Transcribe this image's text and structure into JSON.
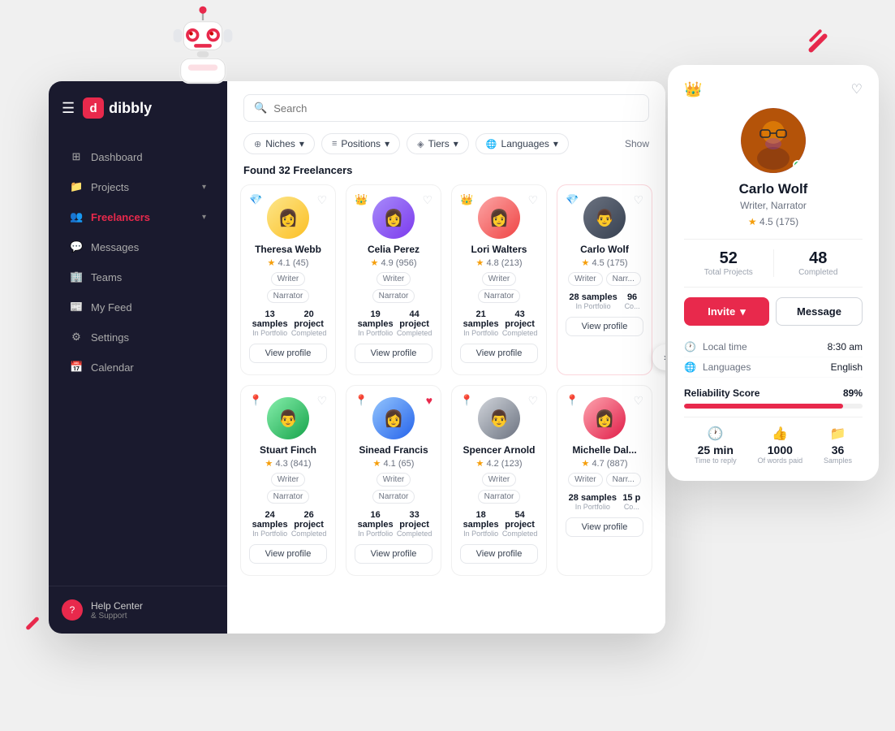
{
  "app": {
    "name": "dibbly",
    "logo_letter": "d"
  },
  "sidebar": {
    "items": [
      {
        "label": "Dashboard",
        "icon": "⊞",
        "active": false
      },
      {
        "label": "Projects",
        "icon": "📁",
        "active": false,
        "hasArrow": true
      },
      {
        "label": "Freelancers",
        "icon": "👥",
        "active": true,
        "hasArrow": true
      },
      {
        "label": "Messages",
        "icon": "💬",
        "active": false
      },
      {
        "label": "Teams",
        "icon": "🏢",
        "active": false
      },
      {
        "label": "My Feed",
        "icon": "📰",
        "active": false
      },
      {
        "label": "Settings",
        "icon": "⚙",
        "active": false
      },
      {
        "label": "Calendar",
        "icon": "📅",
        "active": false
      }
    ],
    "help": {
      "title": "Help Center",
      "subtitle": "& Support"
    }
  },
  "search": {
    "placeholder": "Search"
  },
  "filters": [
    {
      "label": "Niches",
      "icon": "⊕"
    },
    {
      "label": "Positions",
      "icon": "≡"
    },
    {
      "label": "Tiers",
      "icon": "◈"
    },
    {
      "label": "Languages",
      "icon": "🌐"
    }
  ],
  "results": {
    "count": "Found 32 Freelancers",
    "show_label": "Show"
  },
  "freelancers": [
    {
      "name": "Theresa Webb",
      "rating": "4.1",
      "reviews": "45",
      "tags": [
        "Writer",
        "Narrator"
      ],
      "badge": "💎",
      "heart": false,
      "samples": "13 samples",
      "samples_label": "In Portfolio",
      "projects": "20 project",
      "projects_label": "Completed",
      "btn": "View profile"
    },
    {
      "name": "Celia Perez",
      "rating": "4.9",
      "reviews": "956",
      "tags": [
        "Writer",
        "Narrator"
      ],
      "badge": "👑",
      "heart": false,
      "samples": "19 samples",
      "samples_label": "In Portfolio",
      "projects": "44 project",
      "projects_label": "Completed",
      "btn": "View profile"
    },
    {
      "name": "Lori Walters",
      "rating": "4.8",
      "reviews": "213",
      "tags": [
        "Writer",
        "Narrator"
      ],
      "badge": "👑",
      "heart": false,
      "samples": "21 samples",
      "samples_label": "In Portfolio",
      "projects": "43 project",
      "projects_label": "Completed",
      "btn": "View profile"
    },
    {
      "name": "Carlo Wolf",
      "rating": "4.5",
      "reviews": "175",
      "tags": [
        "Writer",
        "Narr..."
      ],
      "badge": "💎",
      "heart": false,
      "samples": "28 samples",
      "samples_label": "In Portfolio",
      "projects": "96",
      "projects_label": "Co...",
      "btn": "View profile"
    },
    {
      "name": "Stuart Finch",
      "rating": "4.3",
      "reviews": "841",
      "tags": [
        "Writer",
        "Narrator"
      ],
      "badge": "📍",
      "heart": false,
      "samples": "24 samples",
      "samples_label": "In Portfolio",
      "projects": "26 project",
      "projects_label": "Completed",
      "btn": "View profile"
    },
    {
      "name": "Sinead Francis",
      "rating": "4.1",
      "reviews": "65",
      "tags": [
        "Writer",
        "Narrator"
      ],
      "badge": "📍",
      "heart": true,
      "samples": "16 samples",
      "samples_label": "In Portfolio",
      "projects": "33 project",
      "projects_label": "Completed",
      "btn": "View profile"
    },
    {
      "name": "Spencer Arnold",
      "rating": "4.2",
      "reviews": "123",
      "tags": [
        "Writer",
        "Narrator"
      ],
      "badge": "📍",
      "heart": false,
      "samples": "18 samples",
      "samples_label": "In Portfolio",
      "projects": "54 project",
      "projects_label": "Completed",
      "btn": "View profile"
    },
    {
      "name": "Michelle Dal...",
      "rating": "4.7",
      "reviews": "887",
      "tags": [
        "Writer",
        "Narr..."
      ],
      "badge": "📍",
      "heart": false,
      "samples": "28 samples",
      "samples_label": "In Portfolio",
      "projects": "15 p",
      "projects_label": "Co...",
      "btn": "View profile"
    }
  ],
  "profile": {
    "name": "Carlo Wolf",
    "title": "Writer, Narrator",
    "rating": "4.5",
    "reviews": "175",
    "total_projects": "52",
    "total_projects_label": "Total Projects",
    "completed": "48",
    "completed_label": "Completed",
    "invite_label": "Invite",
    "message_label": "Message",
    "local_time_label": "Local time",
    "local_time_value": "8:30 am",
    "languages_label": "Languages",
    "languages_value": "English",
    "reliability_label": "Reliability Score",
    "reliability_pct": "89%",
    "reliability_value": 89,
    "time_to_reply_val": "25 min",
    "time_to_reply_label": "Time to reply",
    "words_paid_val": "1000",
    "words_paid_label": "Of words paid",
    "samples_val": "36",
    "samples_label": "Samples"
  }
}
